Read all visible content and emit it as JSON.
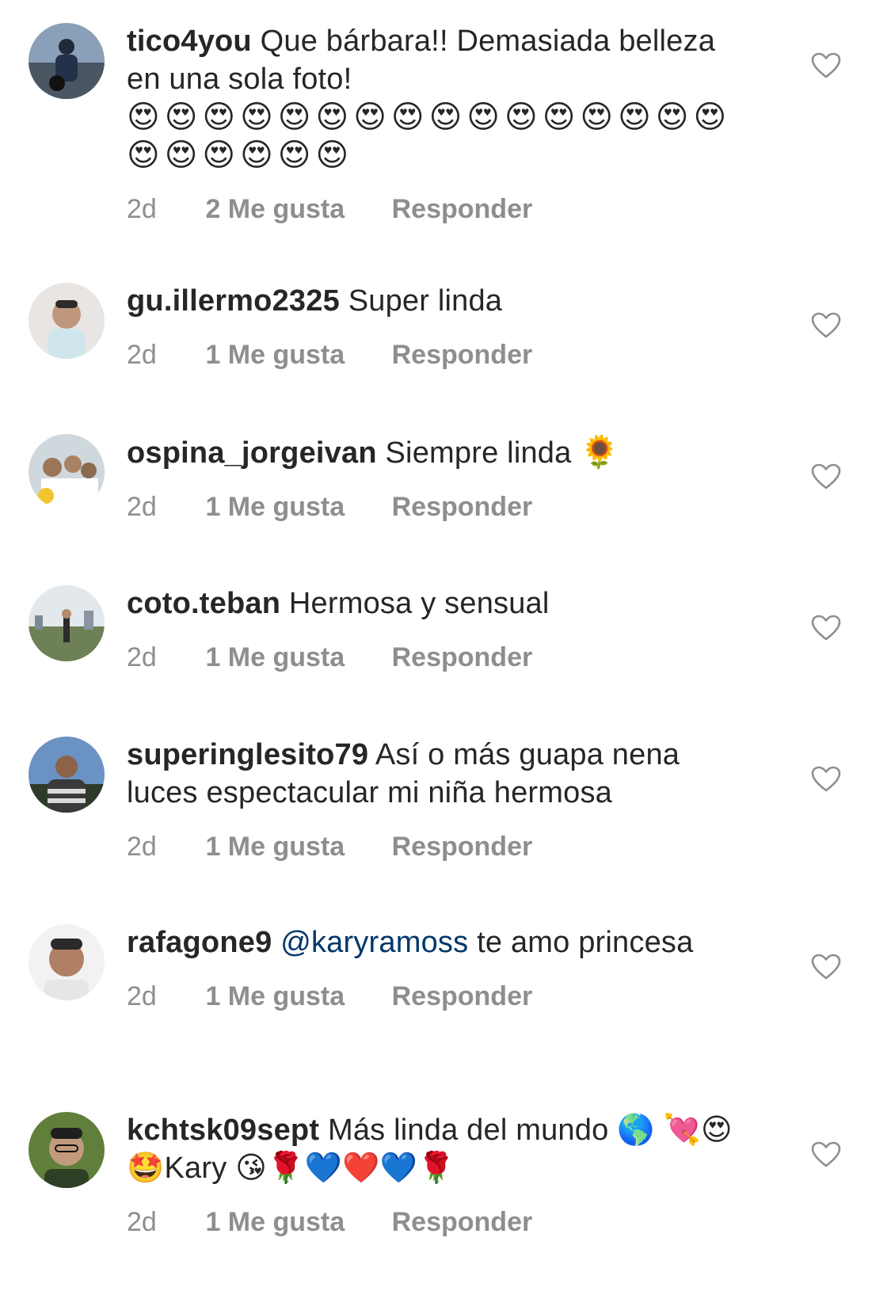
{
  "comments": [
    {
      "username": "tico4you",
      "mention": "",
      "text": "Que bárbara!! Demasiada belleza en una sola foto!",
      "emojis": "😍😍😍😍😍😍😍😍😍😍😍😍😍😍😍😍😍😍😍😍😍😍",
      "time": "2d",
      "likes": "2 Me gusta",
      "reply": "Responder",
      "avatar_colors": [
        "#7f95ad",
        "#2c3440"
      ]
    },
    {
      "username": "gu.illermo2325",
      "mention": "",
      "text": "Super linda",
      "emojis": "",
      "time": "2d",
      "likes": "1 Me gusta",
      "reply": "Responder",
      "avatar_colors": [
        "#e6e2dd",
        "#b98f76"
      ]
    },
    {
      "username": "ospina_jorgeivan",
      "mention": "",
      "text": "Siempre linda",
      "emojis": "🌻",
      "time": "2d",
      "likes": "1 Me gusta",
      "reply": "Responder",
      "avatar_colors": [
        "#c7d3da",
        "#8a6d4e"
      ]
    },
    {
      "username": "coto.teban",
      "mention": "",
      "text": "Hermosa y sensual",
      "emojis": "",
      "time": "2d",
      "likes": "1 Me gusta",
      "reply": "Responder",
      "avatar_colors": [
        "#dfe5ea",
        "#6f7f55"
      ]
    },
    {
      "username": "superinglesito79",
      "mention": "",
      "text": "Así o más guapa nena luces espectacular mi niña hermosa",
      "emojis": "",
      "time": "2d",
      "likes": "1 Me gusta",
      "reply": "Responder",
      "avatar_colors": [
        "#5b86b8",
        "#2a2a2a"
      ]
    },
    {
      "username": "rafagone9",
      "mention": "@karyramoss",
      "text": "te amo princesa",
      "emojis": "",
      "time": "2d",
      "likes": "1 Me gusta",
      "reply": "Responder",
      "avatar_colors": [
        "#f1f1f1",
        "#a77a5d"
      ]
    },
    {
      "username": "kchtsk09sept",
      "mention": "",
      "text": "Más linda del mundo 🌎 💘😍🤩Kary 😘🌹💙❤️💙🌹",
      "emojis": "",
      "time": "2d",
      "likes": "1 Me gusta",
      "reply": "Responder",
      "avatar_colors": [
        "#6f8f3f",
        "#3d4b2a"
      ]
    }
  ]
}
